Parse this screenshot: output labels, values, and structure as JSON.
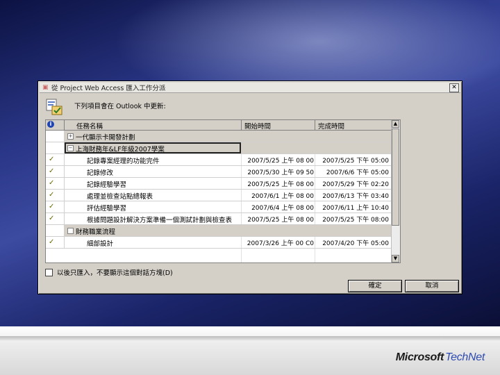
{
  "dialog": {
    "title": "從 Project Web Access 匯入工作分派",
    "close_label": "✕",
    "prompt": "下列項目會在 Outlook 中更新:",
    "info_icon": "i",
    "columns": {
      "name": "任務名稱",
      "start": "開始時間",
      "end": "完成時間"
    },
    "rows": [
      {
        "kind": "summary",
        "expander": "+",
        "name": "一代顯示卡開發計劃",
        "start": "",
        "end": ""
      },
      {
        "kind": "summary",
        "expander": "−",
        "name": "上海財務年&LF年級2007學案",
        "start": "",
        "end": "",
        "selected": true
      },
      {
        "kind": "child",
        "name": "記錄專案經理的功能完件",
        "start": "2007/5/25 上午 08 00",
        "end": "2007/5/25 下午 05:00"
      },
      {
        "kind": "child",
        "name": "記錄修改",
        "start": "2007/5/30 上午 09 50",
        "end": "2007/6/6 下午 05:00"
      },
      {
        "kind": "child",
        "name": "記錄經驗學習",
        "start": "2007/5/25 上午 08 00",
        "end": "2007/5/29 下午 02:20"
      },
      {
        "kind": "child",
        "name": "處理並檢查站點總報表",
        "start": "2007/6/1 上午 08 00",
        "end": "2007/6/13 下午 03:40"
      },
      {
        "kind": "child",
        "name": "評估經驗學習",
        "start": "2007/6/4 上午 08 00",
        "end": "2007/6/11 上午 10:40"
      },
      {
        "kind": "child",
        "name": "根據問題設計解決方案準備一個測試計劃與檢查表",
        "start": "2007/5/25 上午 08 00",
        "end": "2007/5/25 下午 08:00"
      },
      {
        "kind": "summary",
        "expander": "",
        "name": "財務職業流程",
        "start": "",
        "end": ""
      },
      {
        "kind": "child",
        "name": "細部設計",
        "start": "2007/3/26 上午 00 C0",
        "end": "2007/4/20 下午 05:00"
      }
    ],
    "checkbox_label": "以後只匯入，不要顯示這個對話方塊(D)",
    "ok_label": "確定",
    "cancel_label": "取消"
  },
  "brand": {
    "name": "Microsoft",
    "suffix": "TechNet"
  }
}
